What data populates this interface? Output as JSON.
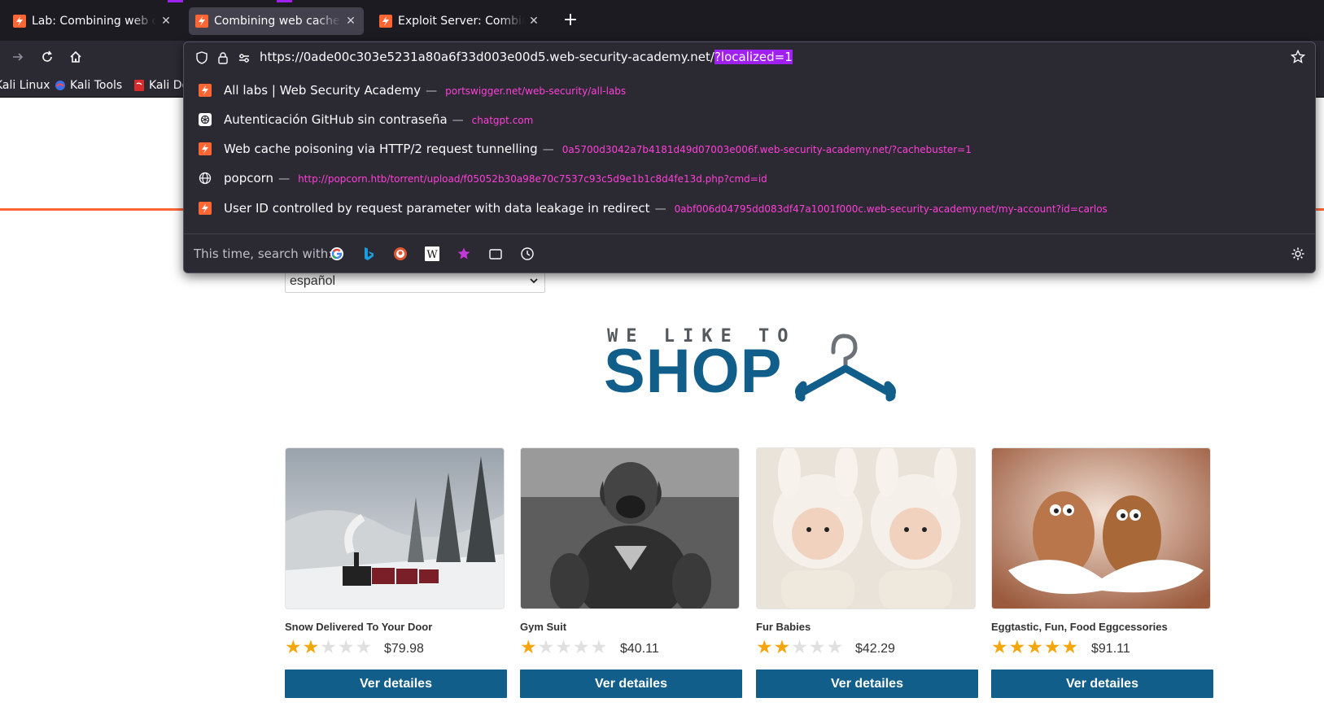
{
  "tabs": [
    {
      "title": "Lab: Combining web cache",
      "active": false
    },
    {
      "title": "Combining web cache poi",
      "active": true
    },
    {
      "title": "Exploit Server: Combining",
      "active": false
    }
  ],
  "bookmarks": [
    {
      "label": "Kali Linux"
    },
    {
      "label": "Kali Tools"
    },
    {
      "label": "Kali Do"
    }
  ],
  "url": {
    "base": "https://0ade00c303e5231a80a6f33d003e00d5.web-security-academy.net/",
    "selected": "?localized=1"
  },
  "suggestions": [
    {
      "title": "All labs | Web Security Academy",
      "url": "portswigger.net/web-security/all-labs",
      "icon": "portswigger-icon"
    },
    {
      "title": "Autenticación GitHub sin contraseña",
      "url": "chatgpt.com",
      "icon": "chatgpt-icon"
    },
    {
      "title": "Web cache poisoning via HTTP/2 request tunnelling",
      "url": "0a5700d3042a7b4181d49d07003e006f.web-security-academy.net/?cachebuster=1",
      "icon": "portswigger-icon"
    },
    {
      "title": "popcorn",
      "url": "http://popcorn.htb/torrent/upload/f05052b30a98e70c7537c93c5d9e1b1c8d4fe13d.php?cmd=id",
      "icon": "globe-icon"
    },
    {
      "title": "User ID controlled by request parameter with data leakage in redirect",
      "url": "0abf006d04795dd083df47a1001f000c.web-security-academy.net/my-account?id=carlos",
      "icon": "portswigger-icon"
    }
  ],
  "search_with_label": "This time, search with:",
  "search_engines": [
    "google-icon",
    "bing-icon",
    "duckduckgo-icon",
    "wikipedia-icon",
    "bookmarks-star-icon",
    "tabs-icon",
    "history-icon"
  ],
  "page": {
    "language": "español",
    "logo_top": "WE LIKE TO",
    "logo_main": "SHOP",
    "accent_color": "#115e8a",
    "products": [
      {
        "name": "Snow Delivered To Your Door",
        "rating": 2,
        "price": "$79.98",
        "button": "Ver detailes"
      },
      {
        "name": "Gym Suit",
        "rating": 1,
        "price": "$40.11",
        "button": "Ver detailes"
      },
      {
        "name": "Fur Babies",
        "rating": 2,
        "price": "$42.29",
        "button": "Ver detailes"
      },
      {
        "name": "Eggtastic, Fun, Food Eggcessories",
        "rating": 5,
        "price": "$91.11",
        "button": "Ver detailes"
      }
    ]
  }
}
